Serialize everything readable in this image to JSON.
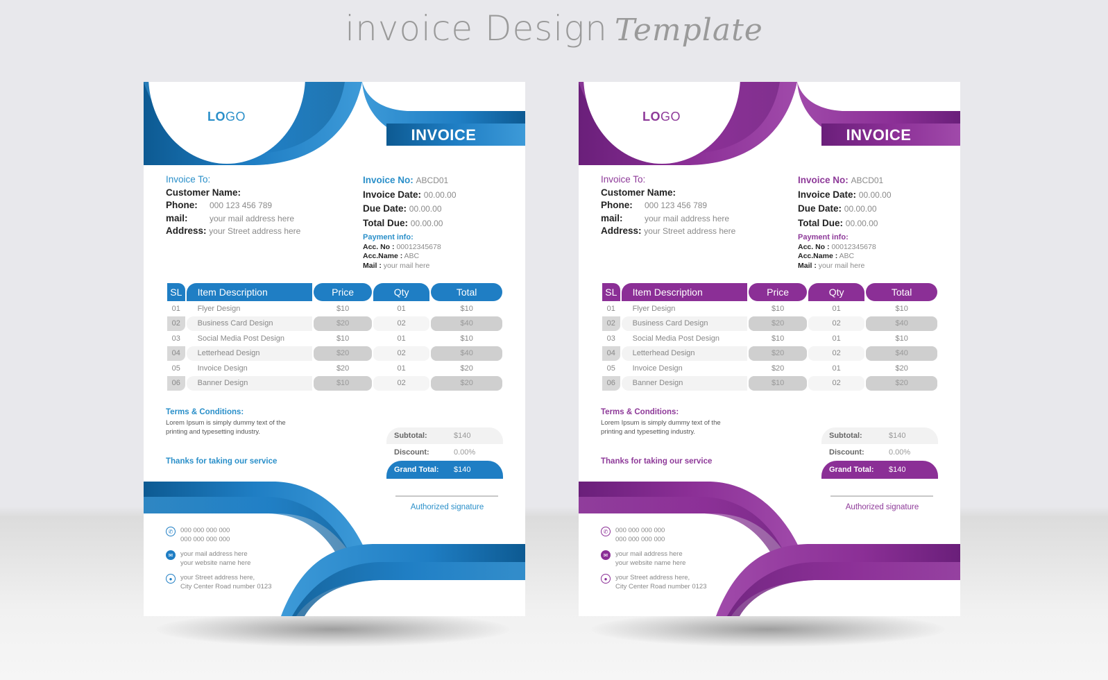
{
  "banner": {
    "title_main": "invoice Design",
    "title_script": "Template"
  },
  "invoices": [
    {
      "theme": "blue",
      "accent": "#1f7ec4",
      "accent_dark": "#0d5a92",
      "accent_light": "#3d9ad8",
      "text_accent": "#2a8fc9",
      "logo_bold": "LO",
      "logo_thin": "GO",
      "doc_title": "INVOICE",
      "bill_to": {
        "heading": "Invoice To:",
        "customer_label": "Customer Name:",
        "phone_label": "Phone:",
        "phone_value": "000 123 456 789",
        "mail_label": "mail:",
        "mail_value": "your mail address here",
        "address_label": "Address:",
        "address_value": "your Street address here"
      },
      "meta": {
        "invoice_no_label": "Invoice No:",
        "invoice_no_value": "ABCD01",
        "invoice_date_label": "Invoice Date:",
        "invoice_date_value": "00.00.00",
        "due_date_label": "Due Date:",
        "due_date_value": "00.00.00",
        "total_due_label": "Total Due:",
        "total_due_value": "00.00.00"
      },
      "payment": {
        "heading": "Payment info:",
        "acc_no_label": "Acc. No :",
        "acc_no_value": "00012345678",
        "acc_name_label": "Acc.Name :",
        "acc_name_value": "ABC",
        "mail_label": "Mail :",
        "mail_value": "your mail here"
      },
      "table": {
        "headers": [
          "SL",
          "Item Description",
          "Price",
          "Qty",
          "Total"
        ],
        "rows": [
          [
            "01",
            "Flyer Design",
            "$10",
            "01",
            "$10"
          ],
          [
            "02",
            "Business Card Design",
            "$20",
            "02",
            "$40"
          ],
          [
            "03",
            "Social Media Post Design",
            "$10",
            "01",
            "$10"
          ],
          [
            "04",
            "Letterhead Design",
            "$20",
            "02",
            "$40"
          ],
          [
            "05",
            "Invoice Design",
            "$20",
            "01",
            "$20"
          ],
          [
            "06",
            "Banner Design",
            "$10",
            "02",
            "$20"
          ]
        ]
      },
      "terms": {
        "heading": "Terms & Conditions:",
        "text": "Lorem Ipsum is simply dummy text of the printing and typesetting industry."
      },
      "thanks": "Thanks for taking our service",
      "summary": {
        "subtotal_label": "Subtotal:",
        "subtotal_value": "$140",
        "discount_label": "Discount:",
        "discount_value": "0.00%",
        "grand_total_label": "Grand Total:",
        "grand_total_value": "$140"
      },
      "signature": "Authorized signature",
      "contact": {
        "phone_1": "000 000 000 000",
        "phone_2": "000 000 000 000",
        "mail": "your mail address here",
        "website": "your website name here",
        "address_1": "your Street address here,",
        "address_2": "City Center Road number 0123"
      }
    },
    {
      "theme": "purple",
      "accent": "#8b2f96",
      "accent_dark": "#6a1f7a",
      "accent_light": "#a04aaa",
      "text_accent": "#8e3a99",
      "logo_bold": "LO",
      "logo_thin": "GO",
      "doc_title": "INVOICE",
      "bill_to": {
        "heading": "Invoice To:",
        "customer_label": "Customer Name:",
        "phone_label": "Phone:",
        "phone_value": "000 123 456 789",
        "mail_label": "mail:",
        "mail_value": "your mail address here",
        "address_label": "Address:",
        "address_value": "your Street address here"
      },
      "meta": {
        "invoice_no_label": "Invoice No:",
        "invoice_no_value": "ABCD01",
        "invoice_date_label": "Invoice Date:",
        "invoice_date_value": "00.00.00",
        "due_date_label": "Due Date:",
        "due_date_value": "00.00.00",
        "total_due_label": "Total Due:",
        "total_due_value": "00.00.00"
      },
      "payment": {
        "heading": "Payment info:",
        "acc_no_label": "Acc. No :",
        "acc_no_value": "00012345678",
        "acc_name_label": "Acc.Name :",
        "acc_name_value": "ABC",
        "mail_label": "Mail :",
        "mail_value": "your mail here"
      },
      "table": {
        "headers": [
          "SL",
          "Item Description",
          "Price",
          "Qty",
          "Total"
        ],
        "rows": [
          [
            "01",
            "Flyer Design",
            "$10",
            "01",
            "$10"
          ],
          [
            "02",
            "Business Card Design",
            "$20",
            "02",
            "$40"
          ],
          [
            "03",
            "Social Media Post Design",
            "$10",
            "01",
            "$10"
          ],
          [
            "04",
            "Letterhead Design",
            "$20",
            "02",
            "$40"
          ],
          [
            "05",
            "Invoice Design",
            "$20",
            "01",
            "$20"
          ],
          [
            "06",
            "Banner Design",
            "$10",
            "02",
            "$20"
          ]
        ]
      },
      "terms": {
        "heading": "Terms & Conditions:",
        "text": "Lorem Ipsum is simply dummy text of the printing and typesetting industry."
      },
      "thanks": "Thanks for taking our service",
      "summary": {
        "subtotal_label": "Subtotal:",
        "subtotal_value": "$140",
        "discount_label": "Discount:",
        "discount_value": "0.00%",
        "grand_total_label": "Grand Total:",
        "grand_total_value": "$140"
      },
      "signature": "Authorized signature",
      "contact": {
        "phone_1": "000 000 000 000",
        "phone_2": "000 000 000 000",
        "mail": "your mail address here",
        "website": "your website name here",
        "address_1": "your Street address here,",
        "address_2": "City Center Road number 0123"
      }
    }
  ]
}
